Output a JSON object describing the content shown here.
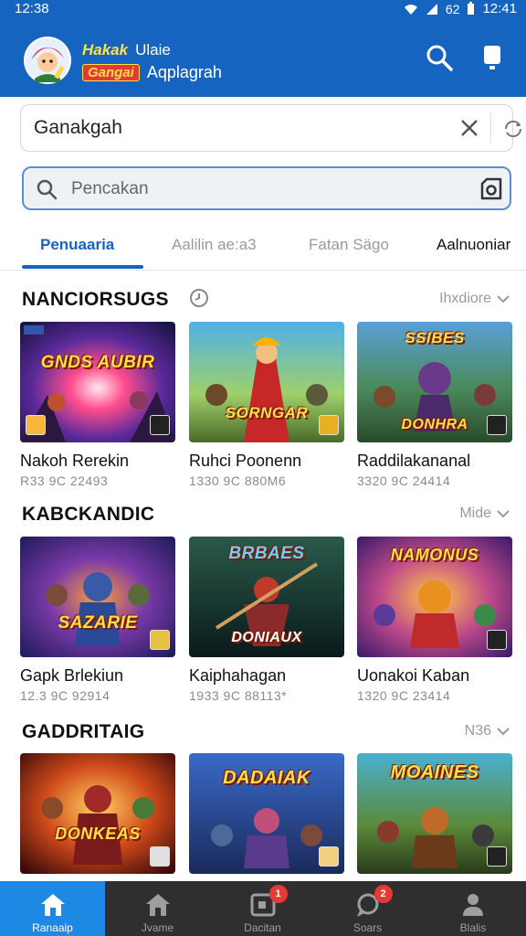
{
  "status_bar": {
    "time": "12:38",
    "battery_text": "62",
    "time_right": "12:41"
  },
  "brand": {
    "line1a": "Hakak",
    "line1b": "Ulaie",
    "line2a": "Gangai",
    "line2b": "Aqplagrah"
  },
  "query_field": {
    "value": "Ganakgah"
  },
  "search": {
    "placeholder": "Pencakan"
  },
  "tabs": [
    {
      "label": "Penuaaria",
      "active": true
    },
    {
      "label": "Aalilin ae:a3",
      "active": false
    },
    {
      "label": "Fatan Sägo",
      "active": false
    },
    {
      "label": "Aalnuoniar",
      "active": false
    }
  ],
  "sections": [
    {
      "title": "NANCIORSUGS",
      "more": "Ihxdiore",
      "cards": [
        {
          "name": "Nakoh Rerekin",
          "meta": "R33 9C 22493",
          "art": "GNDS AUBIR"
        },
        {
          "name": "Ruhci Poonenn",
          "meta": "1330 9C 880M6",
          "art": "SORNGAR"
        },
        {
          "name": "Raddilakananal",
          "meta": "3320 9C 24414",
          "art": "DONHRA"
        }
      ]
    },
    {
      "title": "KABCKANDIC",
      "more": "Mide",
      "cards": [
        {
          "name": "Gapk Brlekiun",
          "meta": "12.3 9C 92914",
          "art": "SAZARIE"
        },
        {
          "name": "Kaiphahagan",
          "meta": "1933 9C 88113*",
          "art": "DONIAUX"
        },
        {
          "name": "Uonakoi Kaban",
          "meta": "1320 9C 23414",
          "art": "NAMONUS"
        }
      ]
    },
    {
      "title": "GADDRITAIG",
      "more": "N36",
      "cards": [
        {
          "name": "",
          "meta": "",
          "art": "DONKEAS"
        },
        {
          "name": "",
          "meta": "",
          "art": "DADAIAK"
        },
        {
          "name": "",
          "meta": "",
          "art": "MOAINES"
        }
      ]
    }
  ],
  "bottom_nav": [
    {
      "label": "Ranaaip",
      "icon": "home-icon",
      "active": true,
      "badge": ""
    },
    {
      "label": "Jvame",
      "icon": "home-outline-icon",
      "active": false,
      "badge": ""
    },
    {
      "label": "Dacitan",
      "icon": "media-icon",
      "active": false,
      "badge": "1"
    },
    {
      "label": "Soars",
      "icon": "chat-icon",
      "active": false,
      "badge": "2"
    },
    {
      "label": "Blalis",
      "icon": "profile-icon",
      "active": false,
      "badge": ""
    }
  ],
  "colors": {
    "primary": "#1565c0",
    "accent": "#1e88e5",
    "badge": "#e53935",
    "art_title": "#ffe04a"
  }
}
